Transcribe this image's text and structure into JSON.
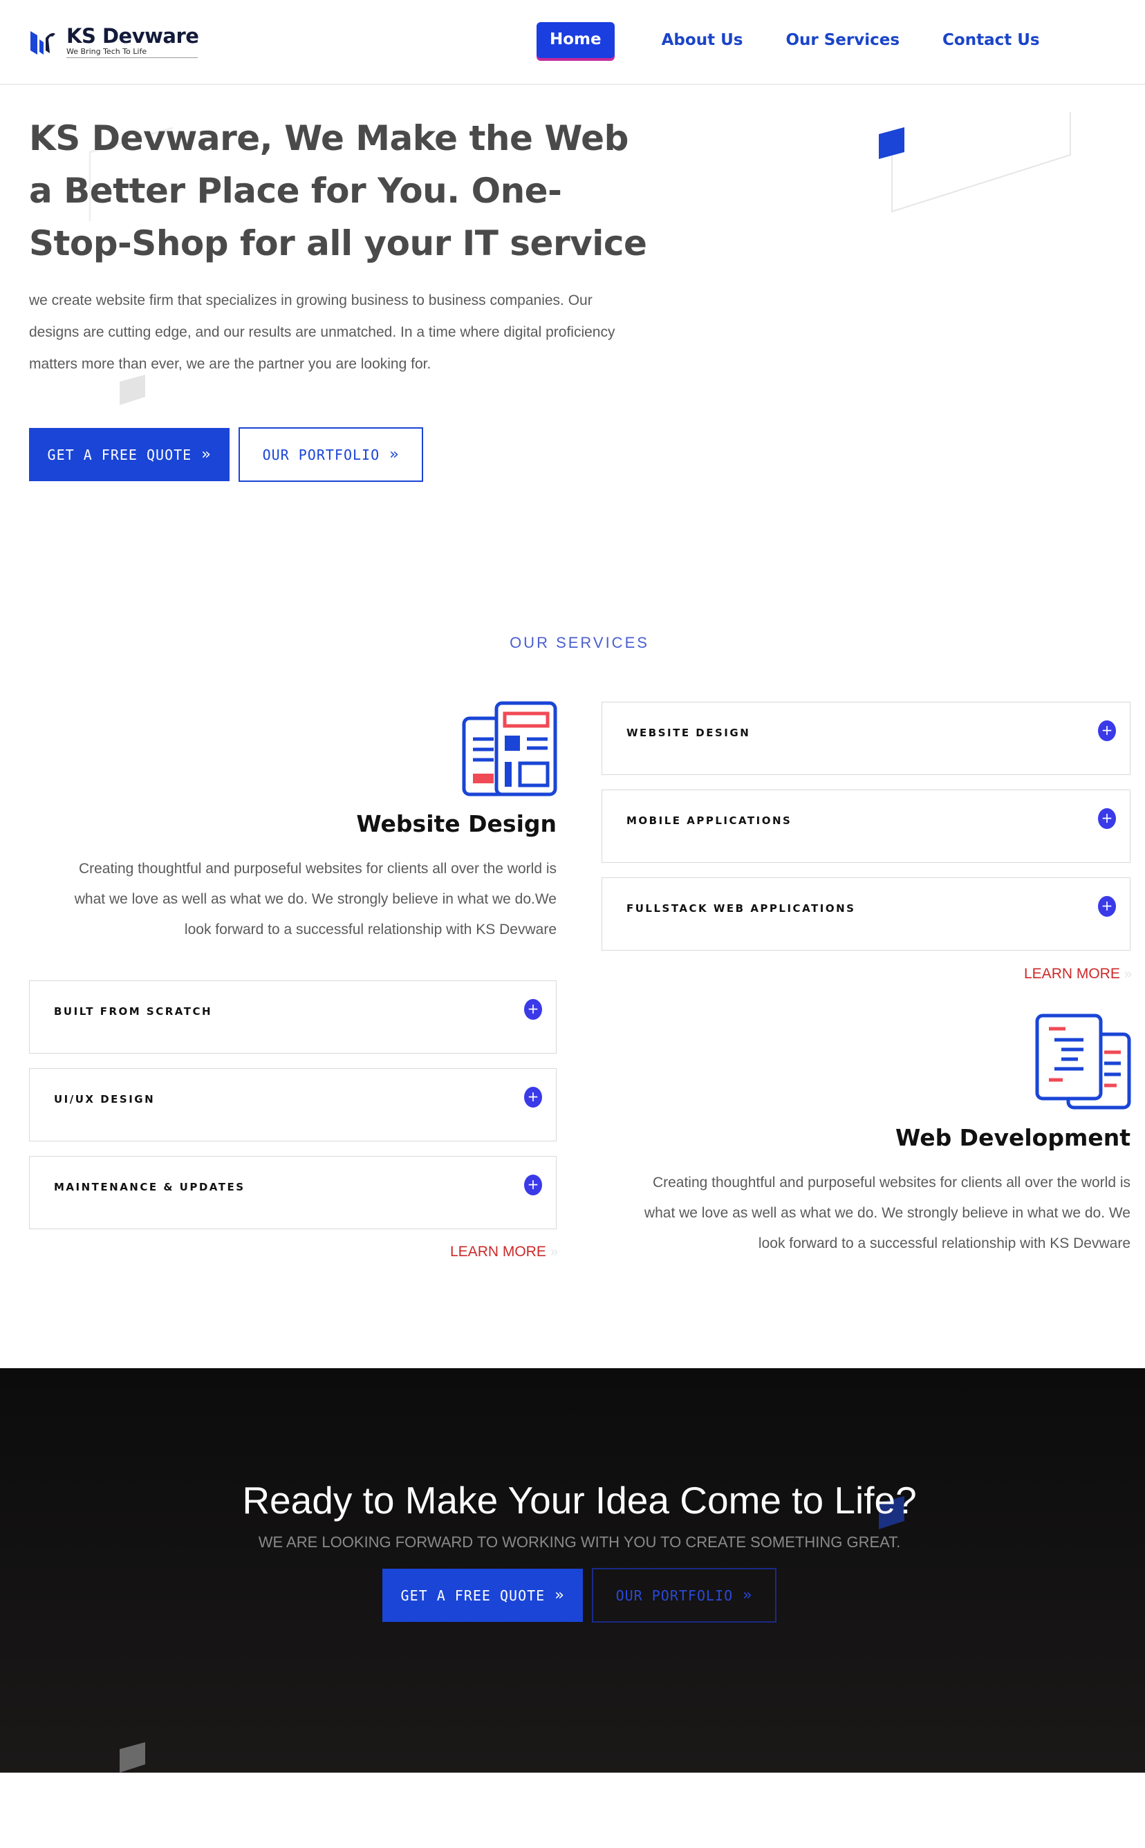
{
  "header": {
    "logo_name": "KS Devware",
    "logo_tagline": "We Bring Tech To Life",
    "nav": [
      {
        "label": "Home",
        "active": true
      },
      {
        "label": "About Us",
        "active": false
      },
      {
        "label": "Our Services",
        "active": false
      },
      {
        "label": "Contact Us",
        "active": false
      }
    ]
  },
  "hero": {
    "title": "KS Devware, We Make the Web a Better Place for You. One-Stop-Shop for all your IT service",
    "text": "we create website firm that specializes in growing business to business companies. Our designs are cutting edge, and our results are unmatched. In a time where digital proficiency matters more than ever, we are the partner you are looking for.",
    "primary_button": "GET A FREE QUOTE",
    "secondary_button": "OUR PORTFOLIO"
  },
  "services": {
    "section_label": "OUR SERVICES",
    "left": {
      "icon": "website-design-icon",
      "title": "Website Design",
      "description": "Creating thoughtful and purposeful websites for clients all over the world is what we love as well as what we do. We strongly believe in what we do.We look forward to a successful relationship with KS Devware",
      "items": [
        "BUILT FROM SCRATCH",
        "UI/UX DESIGN",
        "MAINTENANCE & UPDATES"
      ],
      "learn_more": "LEARN MORE"
    },
    "right": {
      "items": [
        "WEBSITE DESIGN",
        "MOBILE APPLICATIONS",
        "FULLSTACK WEB APPLICATIONS"
      ],
      "learn_more": "LEARN MORE",
      "icon": "web-development-icon",
      "title": "Web Development",
      "description": "Creating thoughtful and purposeful websites for clients all over the world is what we love as well as what we do. We strongly believe in what we do. We look forward to a successful relationship with KS Devware"
    }
  },
  "cta": {
    "title": "Ready to Make Your Idea Come to Life?",
    "subtitle": "WE ARE LOOKING FORWARD TO WORKING WITH YOU TO CREATE SOMETHING GREAT.",
    "primary_button": "GET A FREE QUOTE",
    "secondary_button": "OUR PORTFOLIO"
  },
  "colors": {
    "brand_blue": "#1a45d6",
    "accent_pink": "#c42a9a",
    "learn_more_red": "#cc2a2a",
    "cta_background": "#141212"
  }
}
